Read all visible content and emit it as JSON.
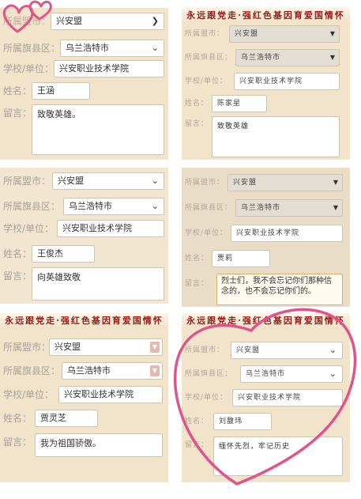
{
  "colors": {
    "banner_red": "#9a1b16",
    "heart_pink": "#e0548a",
    "panel_bg": "#f2e3cb"
  },
  "banner_text": "永远跟党走·强红色基因育爱国情怀",
  "panels": [
    {
      "id": "p1",
      "banner": false,
      "city_label": "所属盟市：",
      "city_value": "兴安盟",
      "county_label": "所属旗县区：",
      "county_value": "乌兰浩特市",
      "school_label": "学校/单位：",
      "school_value": "兴安职业技术学院",
      "name_label": "姓名：",
      "name_value": "王涵",
      "message_label": "留言：",
      "message_value": "致敬英雄。"
    },
    {
      "id": "p2",
      "banner": true,
      "city_label": "所属盟市：",
      "city_value": "兴安盟",
      "county_label": "所属旗县区：",
      "county_value": "乌兰浩特市",
      "school_label": "学校/单位：",
      "school_value": "兴安职业技术学院",
      "name_label": "姓名：",
      "name_value": "陈家星",
      "message_label": "留言：",
      "message_value": "致敬英雄"
    },
    {
      "id": "p3",
      "banner": false,
      "city_label": "所属盟市：",
      "city_value": "兴安盟",
      "county_label": "所属旗县区：",
      "county_value": "乌兰浩特市",
      "school_label": "学校/单位：",
      "school_value": "兴安职业技术学院",
      "name_label": "姓名：",
      "name_value": "王俊杰",
      "message_label": "留言：",
      "message_value": "向英雄致敬"
    },
    {
      "id": "p4",
      "banner": false,
      "city_label": "所属盟市：",
      "city_value": "兴安盟",
      "county_label": "所属旗县区：",
      "county_value": "乌兰浩特市",
      "school_label": "学校/单位：",
      "school_value": "兴安职业技术学院",
      "name_label": "姓名：",
      "name_value": "贾莉",
      "message_label": "留言：",
      "message_value": "烈士们，我不会忘记你们那种信念的，也不会忘记你们的。"
    },
    {
      "id": "p5",
      "banner": true,
      "city_label": "所属盟市：",
      "city_value": "兴安盟",
      "county_label": "所属旗县区：",
      "county_value": "乌兰浩特市",
      "school_label": "学校/单位：",
      "school_value": "兴安职业技术学院",
      "name_label": "姓名：",
      "name_value": "贾灵芝",
      "message_label": "留言：",
      "message_value": "我为祖国骄傲。"
    },
    {
      "id": "p6",
      "banner": true,
      "city_label": "所属盟市：",
      "city_value": "兴安盟",
      "county_label": "所属旗县区：",
      "county_value": "乌兰浩特市",
      "school_label": "学校/单位：",
      "school_value": "兴安职业技术学院",
      "name_label": "姓名：",
      "name_value": "刘馥玮",
      "message_label": "留言：",
      "message_value": "缅怀先烈，牢记历史"
    }
  ]
}
